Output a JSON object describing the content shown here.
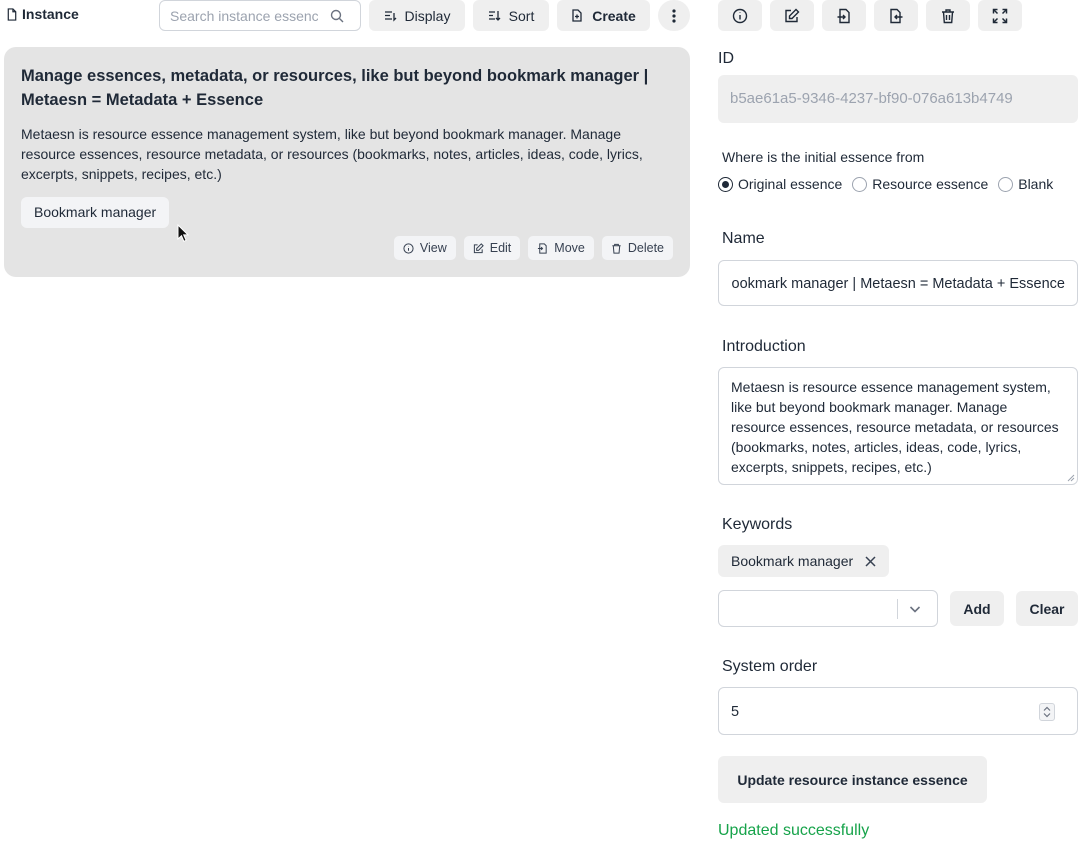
{
  "header": {
    "title": "Instance",
    "search_placeholder": "Search instance essence",
    "display_label": "Display",
    "sort_label": "Sort",
    "create_label": "Create"
  },
  "card": {
    "title": "Manage essences, metadata, or resources, like but beyond bookmark manager | Metaesn = Metadata + Essence",
    "description": "Metaesn is resource essence management system, like but beyond bookmark manager. Manage resource essences, resource metadata, or resources (bookmarks, notes, articles, ideas, code, lyrics, excerpts, snippets, recipes, etc.)",
    "tag": "Bookmark manager",
    "actions": {
      "view": "View",
      "edit": "Edit",
      "move": "Move",
      "delete": "Delete"
    }
  },
  "form": {
    "id_label": "ID",
    "id_value": "b5ae61a5-9346-4237-bf90-076a613b4749",
    "source_question": "Where is the initial essence from",
    "source_options": [
      "Original essence",
      "Resource essence",
      "Blank"
    ],
    "source_selected": "Original essence",
    "name_label": "Name",
    "name_value": "Manage essences, metadata, or resources, like but beyond bookmark manager | Metaesn = Metadata + Essence",
    "intro_label": "Introduction",
    "intro_value": "Metaesn is resource essence management system, like but beyond bookmark manager. Manage resource essences, resource metadata, or resources (bookmarks, notes, articles, ideas, code, lyrics, excerpts, snippets, recipes, etc.)",
    "keywords_label": "Keywords",
    "keywords": [
      "Bookmark manager"
    ],
    "add_label": "Add",
    "clear_label": "Clear",
    "order_label": "System order",
    "order_value": "5",
    "submit_label": "Update resource instance essence",
    "status": "Updated successfully"
  },
  "colors": {
    "success": "#16a34a",
    "card_bg": "#e4e4e4",
    "button_bg": "#efefef"
  },
  "icons": {
    "toolbar_right": [
      "info-icon",
      "edit-icon",
      "import-icon",
      "export-icon",
      "trash-icon",
      "fullscreen-icon"
    ]
  }
}
